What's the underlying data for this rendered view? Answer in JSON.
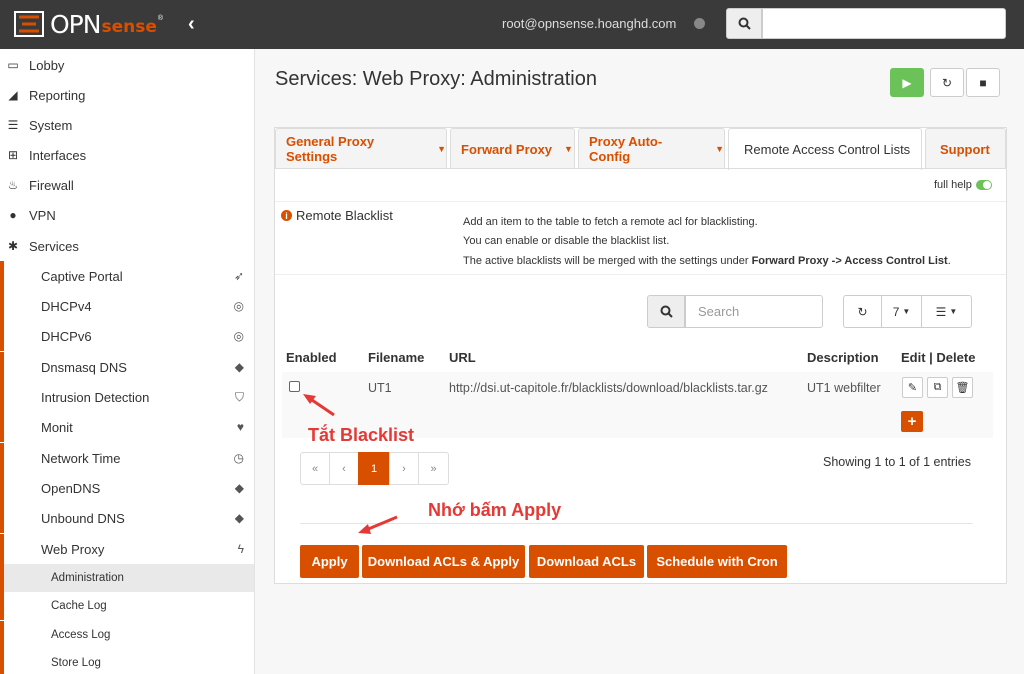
{
  "header": {
    "logo_main": "OPN",
    "logo_accent": "sense",
    "logo_reg": "®",
    "user": "root@opnsense.hoanghd.com",
    "search_placeholder": ""
  },
  "sidebar": {
    "top": [
      {
        "label": "Lobby",
        "icon": "laptop-icon"
      },
      {
        "label": "Reporting",
        "icon": "area-chart-icon"
      },
      {
        "label": "System",
        "icon": "server-icon"
      },
      {
        "label": "Interfaces",
        "icon": "sitemap-icon"
      },
      {
        "label": "Firewall",
        "icon": "fire-icon"
      },
      {
        "label": "VPN",
        "icon": "globe-icon"
      },
      {
        "label": "Services",
        "icon": "cog-icon"
      }
    ],
    "services": [
      {
        "label": "Captive Portal",
        "icon": "paper-plane-icon"
      },
      {
        "label": "DHCPv4",
        "icon": "bullseye-icon"
      },
      {
        "label": "DHCPv6",
        "icon": "bullseye-icon"
      },
      {
        "label": "Dnsmasq DNS",
        "icon": "tags-icon"
      },
      {
        "label": "Intrusion Detection",
        "icon": "shield-icon"
      },
      {
        "label": "Monit",
        "icon": "heartbeat-icon"
      },
      {
        "label": "Network Time",
        "icon": "clock-icon"
      },
      {
        "label": "OpenDNS",
        "icon": "tags-icon"
      },
      {
        "label": "Unbound DNS",
        "icon": "tags-icon"
      },
      {
        "label": "Web Proxy",
        "icon": "bolt-icon"
      }
    ],
    "webproxy": [
      "Administration",
      "Cache Log",
      "Access Log",
      "Store Log"
    ]
  },
  "page": {
    "title": "Services: Web Proxy: Administration"
  },
  "tabs": [
    "General Proxy Settings",
    "Forward Proxy",
    "Proxy Auto-Config",
    "Remote Access Control Lists",
    "Support"
  ],
  "full_help": "full help",
  "section": {
    "title": "Remote Blacklist",
    "help1": "Add an item to the table to fetch a remote acl for blacklisting.",
    "help2": "You can enable or disable the blacklist list.",
    "help3_a": "The active blacklists will be merged with the settings under ",
    "help3_b": "Forward Proxy -> Access Control List",
    "help3_c": "."
  },
  "grid": {
    "search_placeholder": "Search",
    "page_size": "7",
    "columns": [
      "Enabled",
      "Filename",
      "URL",
      "Description",
      "Edit | Delete"
    ],
    "rows": [
      {
        "enabled": false,
        "filename": "UT1",
        "url": "http://dsi.ut-capitole.fr/blacklists/download/blacklists.tar.gz",
        "description": "UT1 webfilter"
      }
    ],
    "pages": [
      "«",
      "‹",
      "1",
      "›",
      "»"
    ],
    "showing": "Showing 1 to 1 of 1 entries"
  },
  "buttons": [
    "Apply",
    "Download ACLs & Apply",
    "Download ACLs",
    "Schedule with Cron"
  ],
  "annotations": {
    "checkbox": "Tắt Blacklist",
    "apply": "Nhớ bấm Apply"
  },
  "colors": {
    "accent": "#d94f00",
    "topbar": "#3a3a3a",
    "annotation": "#e53935",
    "start": "#6ac259"
  }
}
